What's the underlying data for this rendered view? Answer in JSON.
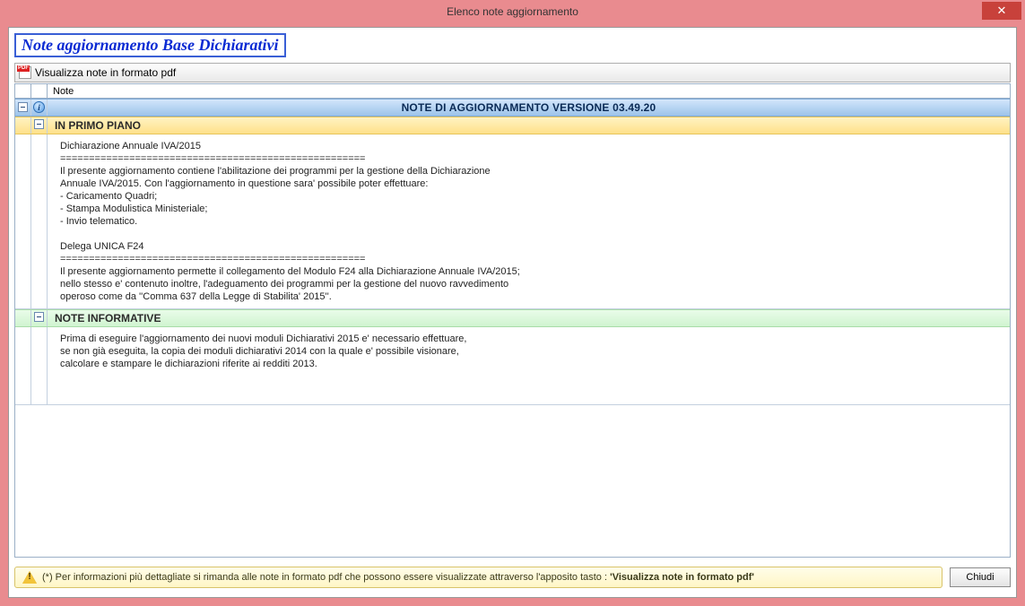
{
  "window": {
    "title": "Elenco note aggiornamento",
    "close_symbol": "✕"
  },
  "heading": "Note aggiornamento Base Dichiarativi",
  "pdfbar": {
    "label": "Visualizza note in formato pdf"
  },
  "grid": {
    "header_col": "Note",
    "version_row": "NOTE DI AGGIORNAMENTO VERSIONE 03.49.20",
    "primo_title": "IN PRIMO PIANO",
    "primo_body": "Dichiarazione Annuale IVA/2015\n=====================================================\nIl presente aggiornamento contiene l'abilitazione dei programmi per la gestione della Dichiarazione\nAnnuale IVA/2015. Con l'aggiornamento in questione sara' possibile poter effettuare:\n- Caricamento Quadri;\n- Stampa Modulistica Ministeriale;\n- Invio telematico.\n\nDelega UNICA F24\n=====================================================\nIl presente aggiornamento permette il collegamento del Modulo F24 alla Dichiarazione Annuale IVA/2015;\nnello stesso e' contenuto inoltre, l'adeguamento dei programmi per la gestione del nuovo ravvedimento\noperoso come da ''Comma 637 della Legge di Stabilita' 2015''.",
    "info_title": "NOTE INFORMATIVE",
    "info_body": "Prima di eseguire l'aggiornamento dei nuovi moduli Dichiarativi 2015 e' necessario effettuare,\nse non già eseguita, la copia dei moduli dichiarativi 2014 con la quale e' possibile visionare,\ncalcolare e stampare le dichiarazioni riferite ai redditi 2013."
  },
  "footer": {
    "hint_prefix": "(*) Per informazioni più dettagliate si rimanda alle note in formato pdf che possono essere visualizzate attraverso l'apposito tasto :",
    "hint_bold": "'Visualizza note in formato pdf'",
    "close_btn": "Chiudi"
  }
}
